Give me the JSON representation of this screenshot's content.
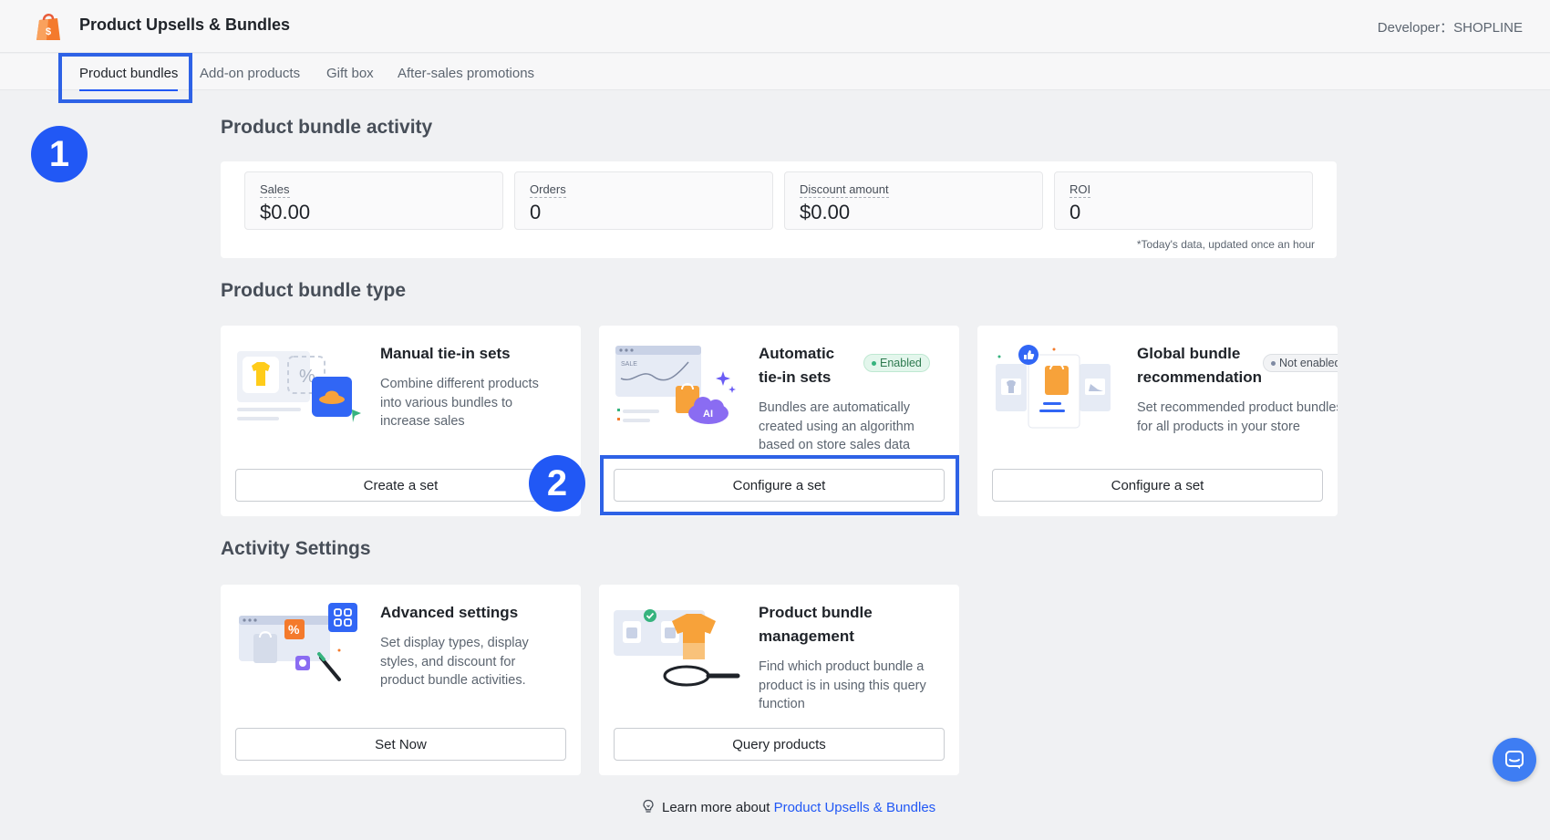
{
  "header": {
    "app_title": "Product Upsells & Bundles",
    "developer_label": "Developer：SHOPLINE"
  },
  "tabs": [
    {
      "label": "Product bundles",
      "active": true
    },
    {
      "label": "Add-on products",
      "active": false
    },
    {
      "label": "Gift box",
      "active": false
    },
    {
      "label": "After-sales promotions",
      "active": false
    }
  ],
  "step_badges": [
    "1",
    "2"
  ],
  "activity": {
    "title": "Product bundle activity",
    "stats": [
      {
        "label": "Sales",
        "value": "$0.00"
      },
      {
        "label": "Orders",
        "value": "0"
      },
      {
        "label": "Discount amount",
        "value": "$0.00"
      },
      {
        "label": "ROI",
        "value": "0"
      }
    ],
    "note": "*Today's data, updated once an hour"
  },
  "bundle_types": {
    "title": "Product bundle type",
    "cards": [
      {
        "title": "Manual tie-in sets",
        "description": "Combine different products into various bundles to increase sales",
        "button": "Create a set"
      },
      {
        "title": "Automatic tie-in sets",
        "status": "Enabled",
        "description": "Bundles are automatically created using an algorithm based on store sales data",
        "button": "Configure a set"
      },
      {
        "title": "Global bundle recommendation",
        "status": "Not enabled",
        "description": "Set recommended product bundles for all products in your store",
        "button": "Configure a set"
      }
    ]
  },
  "activity_settings": {
    "title": "Activity Settings",
    "cards": [
      {
        "title": "Advanced settings",
        "description": "Set display types, display styles, and discount for product bundle activities.",
        "button": "Set Now"
      },
      {
        "title": "Product bundle management",
        "description": "Find which product bundle a product is in using this query function",
        "button": "Query products"
      }
    ]
  },
  "footer": {
    "learn_prefix": "Learn more about ",
    "learn_link": "Product Upsells & Bundles"
  },
  "colors": {
    "accent": "#2158f5",
    "highlight": "#2e62e6",
    "enabled_bg": "#e3f6ec",
    "orange": "#f47a2c"
  },
  "icons": [
    "shopline-bag-logo",
    "bulb-icon",
    "chat-icon"
  ]
}
